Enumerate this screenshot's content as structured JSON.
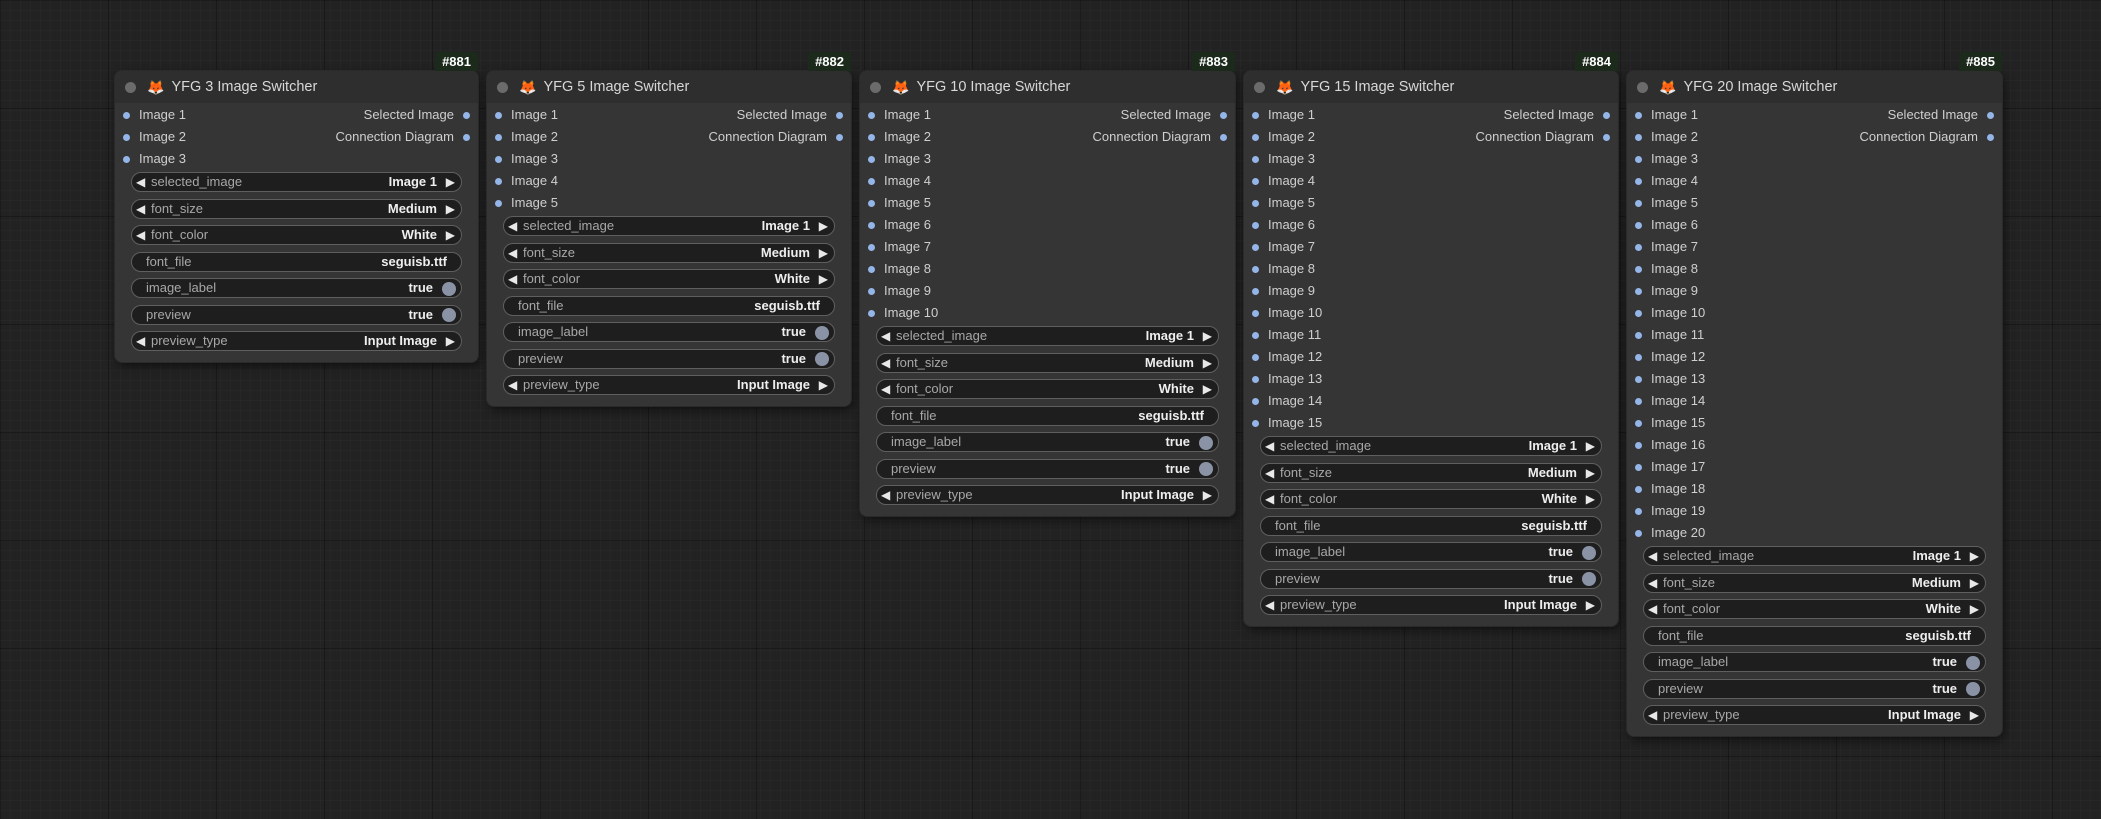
{
  "nodes": [
    {
      "id": "#881",
      "icon": "fox-icon",
      "title": "YFG 3 Image Switcher",
      "inputs": [
        "Image 1",
        "Image 2",
        "Image 3"
      ],
      "outputs": [
        "Selected Image",
        "Connection Diagram"
      ],
      "widgets": {
        "selected_image": {
          "label": "selected_image",
          "value": "Image 1"
        },
        "font_size": {
          "label": "font_size",
          "value": "Medium"
        },
        "font_color": {
          "label": "font_color",
          "value": "White"
        },
        "font_file": {
          "label": "font_file",
          "value": "seguisb.ttf"
        },
        "image_label": {
          "label": "image_label",
          "value": "true"
        },
        "preview": {
          "label": "preview",
          "value": "true"
        },
        "preview_type": {
          "label": "preview_type",
          "value": "Input Image"
        }
      }
    },
    {
      "id": "#882",
      "icon": "fox-icon",
      "title": "YFG 5 Image Switcher",
      "inputs": [
        "Image 1",
        "Image 2",
        "Image 3",
        "Image 4",
        "Image 5"
      ],
      "outputs": [
        "Selected Image",
        "Connection Diagram"
      ],
      "widgets": {
        "selected_image": {
          "label": "selected_image",
          "value": "Image 1"
        },
        "font_size": {
          "label": "font_size",
          "value": "Medium"
        },
        "font_color": {
          "label": "font_color",
          "value": "White"
        },
        "font_file": {
          "label": "font_file",
          "value": "seguisb.ttf"
        },
        "image_label": {
          "label": "image_label",
          "value": "true"
        },
        "preview": {
          "label": "preview",
          "value": "true"
        },
        "preview_type": {
          "label": "preview_type",
          "value": "Input Image"
        }
      }
    },
    {
      "id": "#883",
      "icon": "fox-icon",
      "title": "YFG 10 Image Switcher",
      "inputs": [
        "Image 1",
        "Image 2",
        "Image 3",
        "Image 4",
        "Image 5",
        "Image 6",
        "Image 7",
        "Image 8",
        "Image 9",
        "Image 10"
      ],
      "outputs": [
        "Selected Image",
        "Connection Diagram"
      ],
      "widgets": {
        "selected_image": {
          "label": "selected_image",
          "value": "Image 1"
        },
        "font_size": {
          "label": "font_size",
          "value": "Medium"
        },
        "font_color": {
          "label": "font_color",
          "value": "White"
        },
        "font_file": {
          "label": "font_file",
          "value": "seguisb.ttf"
        },
        "image_label": {
          "label": "image_label",
          "value": "true"
        },
        "preview": {
          "label": "preview",
          "value": "true"
        },
        "preview_type": {
          "label": "preview_type",
          "value": "Input Image"
        }
      }
    },
    {
      "id": "#884",
      "icon": "fox-icon",
      "title": "YFG 15 Image Switcher",
      "inputs": [
        "Image 1",
        "Image 2",
        "Image 3",
        "Image 4",
        "Image 5",
        "Image 6",
        "Image 7",
        "Image 8",
        "Image 9",
        "Image 10",
        "Image 11",
        "Image 12",
        "Image 13",
        "Image 14",
        "Image 15"
      ],
      "outputs": [
        "Selected Image",
        "Connection Diagram"
      ],
      "widgets": {
        "selected_image": {
          "label": "selected_image",
          "value": "Image 1"
        },
        "font_size": {
          "label": "font_size",
          "value": "Medium"
        },
        "font_color": {
          "label": "font_color",
          "value": "White"
        },
        "font_file": {
          "label": "font_file",
          "value": "seguisb.ttf"
        },
        "image_label": {
          "label": "image_label",
          "value": "true"
        },
        "preview": {
          "label": "preview",
          "value": "true"
        },
        "preview_type": {
          "label": "preview_type",
          "value": "Input Image"
        }
      }
    },
    {
      "id": "#885",
      "icon": "fox-icon",
      "title": "YFG 20 Image Switcher",
      "inputs": [
        "Image 1",
        "Image 2",
        "Image 3",
        "Image 4",
        "Image 5",
        "Image 6",
        "Image 7",
        "Image 8",
        "Image 9",
        "Image 10",
        "Image 11",
        "Image 12",
        "Image 13",
        "Image 14",
        "Image 15",
        "Image 16",
        "Image 17",
        "Image 18",
        "Image 19",
        "Image 20"
      ],
      "outputs": [
        "Selected Image",
        "Connection Diagram"
      ],
      "widgets": {
        "selected_image": {
          "label": "selected_image",
          "value": "Image 1"
        },
        "font_size": {
          "label": "font_size",
          "value": "Medium"
        },
        "font_color": {
          "label": "font_color",
          "value": "White"
        },
        "font_file": {
          "label": "font_file",
          "value": "seguisb.ttf"
        },
        "image_label": {
          "label": "image_label",
          "value": "true"
        },
        "preview": {
          "label": "preview",
          "value": "true"
        },
        "preview_type": {
          "label": "preview_type",
          "value": "Input Image"
        }
      }
    }
  ],
  "colors": {
    "canvas_bg": "#222222",
    "node_bg": "#353535",
    "node_header_bg": "#2e2e2e",
    "slot_dot": "#93b5e8",
    "id_badge_bg": "#1b2a1b",
    "widget_bg": "#1e1e1e",
    "toggle_on": "#8a93a6"
  }
}
